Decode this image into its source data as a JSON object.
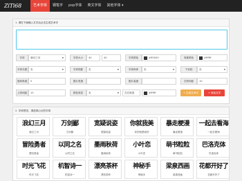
{
  "nav": {
    "logo": "ZiTi68",
    "items": [
      "艺术字体",
      "钢笔字",
      "pop字体",
      "英文字体",
      "其他字体 ▾"
    ]
  },
  "colors": {
    "accent": "#e8453a",
    "generate": "#f0ad4e",
    "input_border": "#4fc7e8"
  },
  "form": {
    "header": "1. 请在下面输入文字后点击生成艺术字",
    "text_value": "",
    "font_label": "字体",
    "font_value": "浪幻三月",
    "size_label": "字体大小",
    "size_a": "40",
    "size_b": "40",
    "color_label": "字体颜色",
    "color_value": "#ff0000",
    "bgcolor_label": "背景颜色",
    "bgcolor_value": "#ffffff",
    "effect_label": "字体光晕",
    "effect_value": "无",
    "shadow_label": "字体阴影",
    "shadow_value": "无",
    "tilt_label": "字体斜体",
    "tilt_value": "无",
    "underline_label": "下划线",
    "underline_value": "无",
    "rotate_label": "旋转角度",
    "rotate_value": "0",
    "width_label": "图片宽度",
    "width_value": "",
    "height_label": "图片高度",
    "height_value": "",
    "spacing_label": "左侧间距",
    "spacing_value": "10",
    "top_label": "上侧间距",
    "top_value": "10",
    "format_label": "颜色渐变",
    "format_value": "无",
    "gradient_value": "左右渐变",
    "gradient_color": "#ffffff",
    "generate_button": "+ 生成艺术字",
    "add_button": "+ 添加文字"
  },
  "fonts_panel": {
    "header": "2. 字体预览，请选择心仪的字体",
    "items": [
      {
        "art": "浪幻三月",
        "caption": "浪幻三月"
      },
      {
        "art": "万剑鄙",
        "caption": "万剑鄙"
      },
      {
        "art": "宽疑说姿",
        "caption": "宽疑说姿"
      },
      {
        "art": "你就我美",
        "caption": "你的就是我的"
      },
      {
        "art": "暴走梗漫",
        "caption": "暴走梗漫"
      },
      {
        "art": "一起去看海",
        "caption": "一起去看海"
      },
      {
        "art": "冒险勇者",
        "caption": "冒险勇者"
      },
      {
        "art": "以同之名",
        "caption": "以同之名"
      },
      {
        "art": "墨雨秋荷",
        "caption": "墨雨秋荷"
      },
      {
        "art": "小叶恋",
        "caption": "小叶恋"
      },
      {
        "art": "萌书粒粒",
        "caption": "萌书粒粒"
      },
      {
        "art": "巴洛克体",
        "caption": "巴洛克体"
      },
      {
        "art": "时光飞花",
        "caption": "时光飞花"
      },
      {
        "art": "机智诗一",
        "caption": "机智诗一"
      },
      {
        "art": "漂亮茶杯",
        "caption": "漂亮茶杯"
      },
      {
        "art": "神秘手",
        "caption": "神秘手"
      },
      {
        "art": "梁泉西画",
        "caption": "梁泉西画"
      },
      {
        "art": "花都开好了",
        "caption": "花都开好了"
      }
    ]
  }
}
